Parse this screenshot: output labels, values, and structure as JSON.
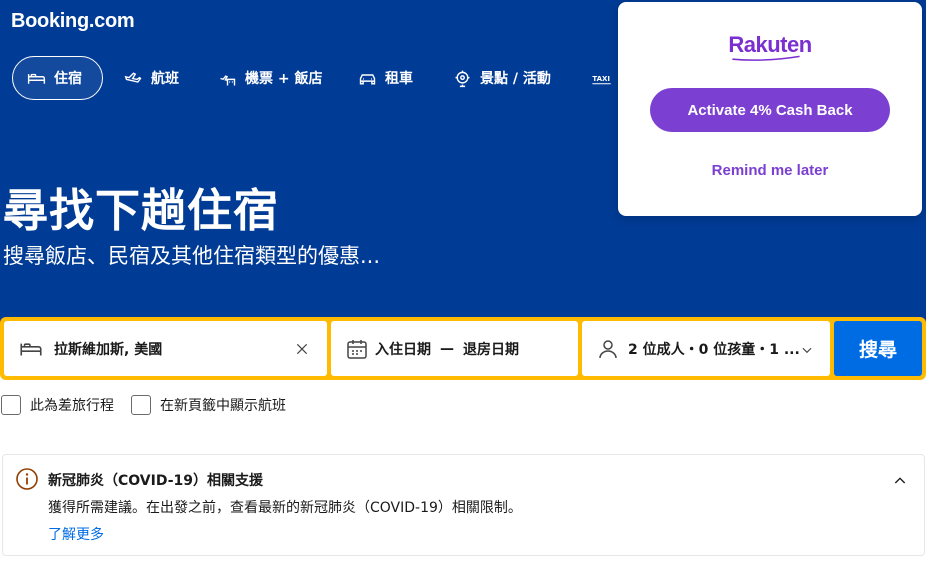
{
  "brand": {
    "logo": "Booking.com"
  },
  "nav": {
    "tabs": [
      {
        "label": "住宿",
        "icon": "bed-icon",
        "active": true
      },
      {
        "label": "航班",
        "icon": "plane-icon"
      },
      {
        "label": "機票 + 飯店",
        "icon": "flight-hotel-icon"
      },
      {
        "label": "租車",
        "icon": "car-icon"
      },
      {
        "label": "景點 / 活動",
        "icon": "attractions-icon"
      },
      {
        "label": "",
        "icon": "taxi-icon",
        "icon_text": "TAXI"
      }
    ]
  },
  "hero": {
    "title": "尋找下趟住宿",
    "subtitle": "搜尋飯店、民宿及其他住宿類型的優惠..."
  },
  "search": {
    "destination": "拉斯維加斯, 美國",
    "checkin_label": "入住日期",
    "dates_separator": "—",
    "checkout_label": "退房日期",
    "guests": "2 位成人・0 位孩童・1 ...",
    "button_label": "搜尋",
    "colors": {
      "bar": "#febb02",
      "button": "#006ce4"
    }
  },
  "options": {
    "business_trip": "此為差旅行程",
    "flights_new_tab": "在新頁籤中顯示航班"
  },
  "notice": {
    "title": "新冠肺炎（COVID-19）相關支援",
    "text": "獲得所需建議。在出發之前，查看最新的新冠肺炎（COVID-19）相關限制。",
    "link": "了解更多",
    "icon": "info-icon"
  },
  "rakuten": {
    "logo": "Rakuten",
    "activate_label": "Activate 4% Cash Back",
    "remind_label": "Remind me later",
    "colors": {
      "brand": "#7b3fd1"
    }
  },
  "colors": {
    "header_bg": "#003b95",
    "link": "#006ce4"
  }
}
